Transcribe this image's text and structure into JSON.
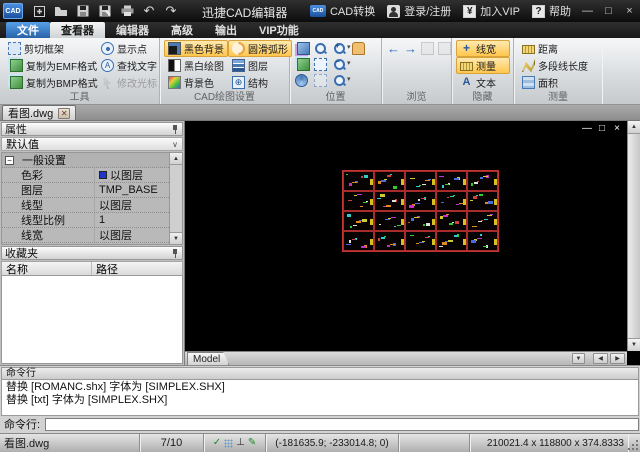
{
  "titlebar": {
    "logo_text": "CAD",
    "title": "迅捷CAD编辑器",
    "cad_convert": "CAD转换",
    "login": "登录/注册",
    "vip": "加入VIP",
    "help": "帮助",
    "vip_symbol": "¥",
    "help_symbol": "?",
    "mini_logo_text": "CAD"
  },
  "menu_tabs": {
    "file": "文件",
    "viewer": "查看器",
    "editor": "编辑器",
    "advanced": "高级",
    "output": "输出",
    "vip": "VIP功能"
  },
  "ribbon": {
    "tools": {
      "label": "工具",
      "buttons": {
        "clip_frame": "剪切框架",
        "copy_emf": "复制为EMF格式",
        "copy_bmp": "复制为BMP格式",
        "show_point": "显示点",
        "find_text": "查找文字",
        "modify_cursor": "修改光标"
      }
    },
    "cad_settings": {
      "label": "CAD绘图设置",
      "buttons": {
        "black_bg": "黑色背景",
        "bw_draw": "黑白绘图",
        "bg_color": "背景色",
        "smooth_arc": "圆滑弧形",
        "layers": "图层",
        "structure": "结构"
      }
    },
    "position": {
      "label": "位置"
    },
    "browse": {
      "label": "浏览"
    },
    "hide": {
      "label": "隐藏",
      "buttons": {
        "line_width": "线宽",
        "measure": "测量",
        "text": "文本"
      }
    },
    "measure": {
      "label": "测量",
      "buttons": {
        "distance": "距离",
        "polyline_length": "多段线长度",
        "area": "面积"
      }
    }
  },
  "document_tab": {
    "title": "看图.dwg"
  },
  "properties_panel": {
    "header": "属性",
    "preset": "默认值",
    "group": "一般设置",
    "rows": [
      {
        "label": "色彩",
        "value": "以图层"
      },
      {
        "label": "图层",
        "value": "TMP_BASE"
      },
      {
        "label": "线型",
        "value": "以图层"
      },
      {
        "label": "线型比例",
        "value": "1"
      },
      {
        "label": "线宽",
        "value": "以图层"
      }
    ],
    "swatch_color": "#2233cc"
  },
  "favorites_panel": {
    "header": "收藏夹",
    "col_name": "名称",
    "col_path": "路径"
  },
  "canvas": {
    "model_tab": "Model",
    "grid": {
      "rows": 4,
      "cols": 5
    },
    "border_color": "#b43030",
    "palette": [
      "#2ecc2e",
      "#cc2ecc",
      "#2ecccc",
      "#cccc2e",
      "#d04040",
      "#4a6ae0",
      "#e0e0e0",
      "#e08a20"
    ]
  },
  "command_panel": {
    "header": "命令行",
    "lines": [
      "替换 [ROMANC.shx] 字体为 [SIMPLEX.SHX]",
      "替换 [txt] 字体为 [SIMPLEX.SHX]"
    ],
    "prompt_label": "命令行:",
    "input_value": ""
  },
  "statusbar": {
    "file": "看图.dwg",
    "page": "7/10",
    "coords": "(-181635.9; -233014.8; 0)",
    "dims": "210021.4 x 118800 x 374.8333"
  },
  "glyphs": {
    "undo": "↶",
    "redo": "↷",
    "back": "←",
    "forward": "→",
    "caret_down": "▾",
    "chevron_down": "∨",
    "scroll_up": "▲",
    "scroll_down": "▼",
    "scroll_left": "◀",
    "scroll_right": "▶",
    "minimize": "—",
    "maximize": "□",
    "restore": "□",
    "close": "×",
    "tab_close": "✕",
    "expander_minus": "−",
    "snap_check": "✓",
    "ortho": "⊥",
    "draw_pencil": "✎",
    "zoom_plus": "+",
    "zoom_minus": "−",
    "struct_link": "⊕",
    "find_a": "A"
  }
}
